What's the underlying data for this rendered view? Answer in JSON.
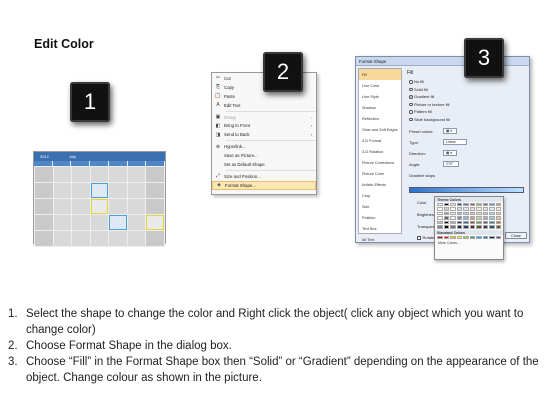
{
  "title": "Edit Color",
  "badges": [
    "1",
    "2",
    "3"
  ],
  "calendar": {
    "year": "2012",
    "month": "July"
  },
  "menu": {
    "items": [
      {
        "label": "Cut",
        "icon": "cut-icon",
        "glyph": "✂",
        "state": "normal",
        "arrow": ""
      },
      {
        "label": "Copy",
        "icon": "copy-icon",
        "glyph": "⎘",
        "state": "normal",
        "arrow": ""
      },
      {
        "label": "Paste",
        "icon": "paste-icon",
        "glyph": "📋",
        "state": "normal",
        "arrow": ""
      },
      {
        "label": "Edit Text",
        "icon": "edit-text-icon",
        "glyph": "A",
        "state": "normal",
        "arrow": ""
      },
      {
        "label": "Group",
        "icon": "group-icon",
        "glyph": "▣",
        "state": "disabled",
        "arrow": "›"
      },
      {
        "label": "Bring to Front",
        "icon": "bring-front-icon",
        "glyph": "◧",
        "state": "normal",
        "arrow": "›"
      },
      {
        "label": "Send to Back",
        "icon": "send-back-icon",
        "glyph": "◨",
        "state": "normal",
        "arrow": "›"
      },
      {
        "label": "Hyperlink...",
        "icon": "hyperlink-icon",
        "glyph": "⊕",
        "state": "normal",
        "arrow": ""
      },
      {
        "label": "Save as Picture...",
        "icon": "",
        "glyph": "",
        "state": "normal",
        "arrow": ""
      },
      {
        "label": "Set as Default Shape",
        "icon": "",
        "glyph": "",
        "state": "normal",
        "arrow": ""
      },
      {
        "label": "Size and Position...",
        "icon": "size-position-icon",
        "glyph": "⤢",
        "state": "normal",
        "arrow": ""
      },
      {
        "label": "Format Shape...",
        "icon": "format-shape-icon",
        "glyph": "◈",
        "state": "hover",
        "arrow": ""
      }
    ]
  },
  "dialog": {
    "title": "Format Shape",
    "sidebar": [
      "Fill",
      "Line Color",
      "Line Style",
      "Shadow",
      "Reflection",
      "Glow and Soft Edges",
      "3-D Format",
      "3-D Rotation",
      "Picture Corrections",
      "Picture Color",
      "Artistic Effects",
      "Crop",
      "Size",
      "Position",
      "Text Box",
      "Alt Text"
    ],
    "heading": "Fill",
    "options": [
      "No fill",
      "Solid fill",
      "Gradient fill",
      "Picture or texture fill",
      "Pattern fill",
      "Slide background fill"
    ],
    "preset_label": "Preset colors:",
    "type_label": "Type:",
    "type_value": "Linear",
    "direction_label": "Direction:",
    "angle_label": "Angle:",
    "angle_value": "270°",
    "stops_label": "Gradient stops",
    "color_label": "Color",
    "position_label": "Position:",
    "position_value": "0%",
    "brightness_label": "Brightness",
    "transparency_label": "Transparency",
    "rotate_label": "Rotate",
    "close_label": "Close"
  },
  "palette": {
    "theme_label": "Theme Colors",
    "standard_label": "Standard Colors",
    "more_label": "More Colors...",
    "theme_top": [
      "#ffffff",
      "#000000",
      "#eeece1",
      "#1f497d",
      "#4f81bd",
      "#c0504d",
      "#9bbb59",
      "#8064a2",
      "#4bacc6",
      "#f79646"
    ],
    "standard": [
      "#c00000",
      "#ff0000",
      "#ffc000",
      "#ffff00",
      "#92d050",
      "#00b050",
      "#00b0f0",
      "#0070c0",
      "#002060",
      "#7030a0"
    ]
  },
  "steps": [
    {
      "n": "1.",
      "text": "Select the shape to change the color and Right click the object( click any object which you want to change color)"
    },
    {
      "n": "2.",
      "text": "Choose Format Shape in the dialog box."
    },
    {
      "n": "3.",
      "text": "Choose “Fill” in the Format Shape box then “Solid” or “Gradient” depending on the appearance of the object. Change colour as shown in the picture."
    }
  ]
}
